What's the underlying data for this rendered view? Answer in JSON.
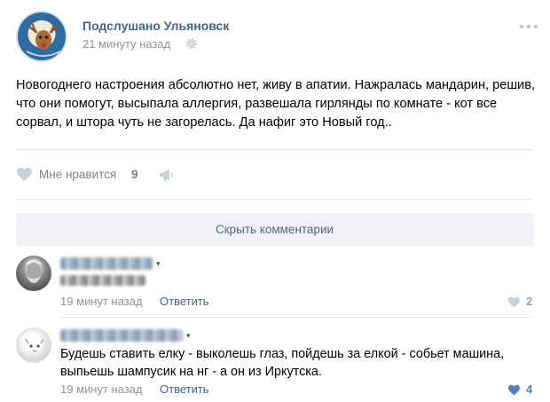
{
  "post": {
    "group_name": "Подслушано Ульяновск",
    "time": "21 минуту назад",
    "text": "Новогоднего настроения абсолютно нет, живу в апатии. Нажралась мандарин, решив, что они помогут, высыпала аллергия, развешала гирлянды по комнате - кот все сорвал, и штора чуть не загорелась. Да нафиг это Новый год..",
    "like_label": "Мне нравится",
    "like_count": "9"
  },
  "comments_toggle": {
    "label": "Скрыть комментарии"
  },
  "comments": [
    {
      "time": "19 минут назад",
      "reply_label": "Ответить",
      "like_count": "2",
      "liked": false
    },
    {
      "text": "Будешь ставить елку - выколешь глаз, пойдешь за елкой - собьет машина, выпьешь шампусик на нг - а он из Иркутска.",
      "time": "19 минут назад",
      "reply_label": "Ответить",
      "like_count": "4",
      "liked": true
    }
  ],
  "icons": {
    "gear": "gear-icon",
    "more": "more-dots-icon",
    "like": "heart-icon",
    "share": "megaphone-icon",
    "caret": "caret-down-icon"
  },
  "colors": {
    "link": "#42648b",
    "muted": "#939393",
    "like_inactive": "#c5d0db",
    "like_active": "#5181b8",
    "button_bg": "#f0f2f5"
  }
}
